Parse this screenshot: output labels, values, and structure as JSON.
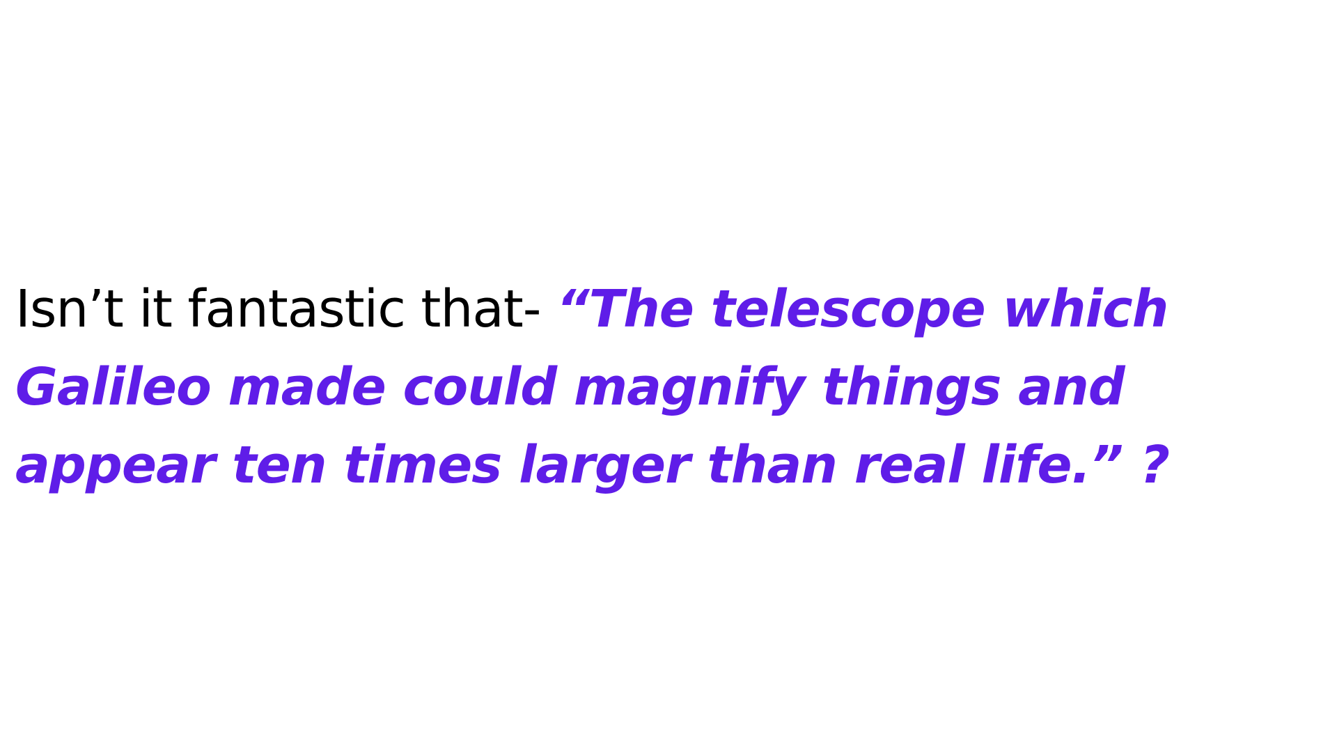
{
  "slide": {
    "intro_text": "Isn’t it fantastic that- ",
    "quote_text": "“The telescope which Galileo made could magnify things and appear ten times larger than real life.” ?",
    "colors": {
      "background": "#ffffff",
      "intro": "#000000",
      "quote": "#5f1de8"
    }
  }
}
